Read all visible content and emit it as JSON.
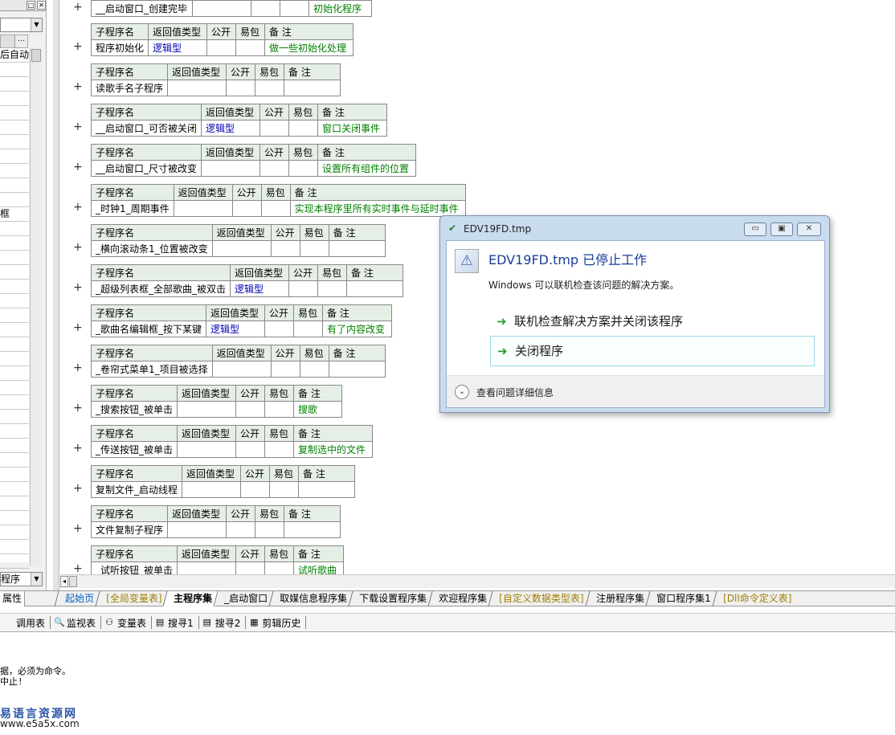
{
  "left_panel": {
    "combo_arrow": "▼",
    "header_dots": "…",
    "rows": [
      "后自动",
      "",
      "",
      "",
      "",
      "",
      "",
      "",
      "",
      "",
      "",
      "框",
      "",
      "",
      "",
      "",
      "",
      "",
      "",
      "",
      "",
      "",
      "",
      "",
      "",
      "",
      "",
      "",
      "",
      "",
      "",
      "",
      "",
      "",
      "",
      ""
    ],
    "bottom_combo": "程序",
    "tab_label": "属性"
  },
  "code": {
    "top_partial": {
      "name": "__启动窗口_创建完毕",
      "note": "初始化程序"
    },
    "subs": [
      {
        "name": "程序初始化",
        "type": "逻辑型",
        "note": "做一些初始化处理"
      },
      {
        "name": "读歌手名子程序",
        "type": "",
        "note": ""
      },
      {
        "name": "__启动窗口_可否被关闭",
        "type": "逻辑型",
        "note": "窗口关闭事件"
      },
      {
        "name": "__启动窗口_尺寸被改变",
        "type": "",
        "note": "设置所有组件的位置"
      },
      {
        "name": "_时钟1_周期事件",
        "type": "",
        "note": "实现本程序里所有实时事件与延时事件"
      },
      {
        "name": "_横向滚动条1_位置被改变",
        "type": "",
        "note": ""
      },
      {
        "name": "_超级列表框_全部歌曲_被双击",
        "type": "逻辑型",
        "note": ""
      },
      {
        "name": "_歌曲名编辑框_按下某键",
        "type": "逻辑型",
        "note": "有了内容改变"
      },
      {
        "name": "_卷帘式菜单1_项目被选择",
        "type": "",
        "note": ""
      },
      {
        "name": "_搜索按钮_被单击",
        "type": "",
        "note": "搜歌"
      },
      {
        "name": "_传送按钮_被单击",
        "type": "",
        "note": "复制选中的文件"
      },
      {
        "name": "复制文件_启动线程",
        "type": "",
        "note": ""
      },
      {
        "name": "文件复制子程序",
        "type": "",
        "note": ""
      },
      {
        "name": "_试听按钮_被单击",
        "type": "",
        "note": "试听歌曲"
      }
    ],
    "headers": {
      "name": "子程序名",
      "type": "返回值类型",
      "public": "公开",
      "easy": "易包",
      "note": "备 注"
    },
    "plus": "+"
  },
  "tabs": [
    {
      "label": "起始页",
      "style": "start"
    },
    {
      "label": "[全局变量表]",
      "style": "yellow"
    },
    {
      "label": "主程序集",
      "style": "active"
    },
    {
      "label": "_启动窗口",
      "style": ""
    },
    {
      "label": "取媒信息程序集",
      "style": ""
    },
    {
      "label": "下载设置程序集",
      "style": ""
    },
    {
      "label": "欢迎程序集",
      "style": ""
    },
    {
      "label": "[自定义数据类型表]",
      "style": "yellow"
    },
    {
      "label": "注册程序集",
      "style": ""
    },
    {
      "label": "窗口程序集1",
      "style": ""
    },
    {
      "label": "[Dll命令定义表]",
      "style": "yellow"
    }
  ],
  "toolbar": [
    {
      "icon": "call-table-icon",
      "glyph": "",
      "label": "调用表"
    },
    {
      "icon": "magnifier-icon",
      "glyph": "🔍",
      "label": "监视表"
    },
    {
      "icon": "variable-icon",
      "glyph": "⚇",
      "label": "变量表"
    },
    {
      "icon": "search1-icon",
      "glyph": "▤",
      "label": "搜寻1"
    },
    {
      "icon": "search2-icon",
      "glyph": "▤",
      "label": "搜寻2"
    },
    {
      "icon": "clip-history-icon",
      "glyph": "▦",
      "label": "剪辑历史"
    }
  ],
  "output": {
    "line1": "据，必须为命令。",
    "line2": "中止!"
  },
  "watermark": {
    "title": "易语言资源网",
    "url": "www.e5a5x.com"
  },
  "dialog": {
    "title": "EDV19FD.tmp",
    "heading": "EDV19FD.tmp 已停止工作",
    "subtext": "Windows 可以联机检查该问题的解决方案。",
    "option1": "联机检查解决方案并关闭该程序",
    "option2": "关闭程序",
    "details": "查看问题详细信息",
    "btn_min": "▭",
    "btn_max": "▣",
    "btn_close": "✕",
    "arrow": "➜",
    "chevron": "⌄"
  }
}
